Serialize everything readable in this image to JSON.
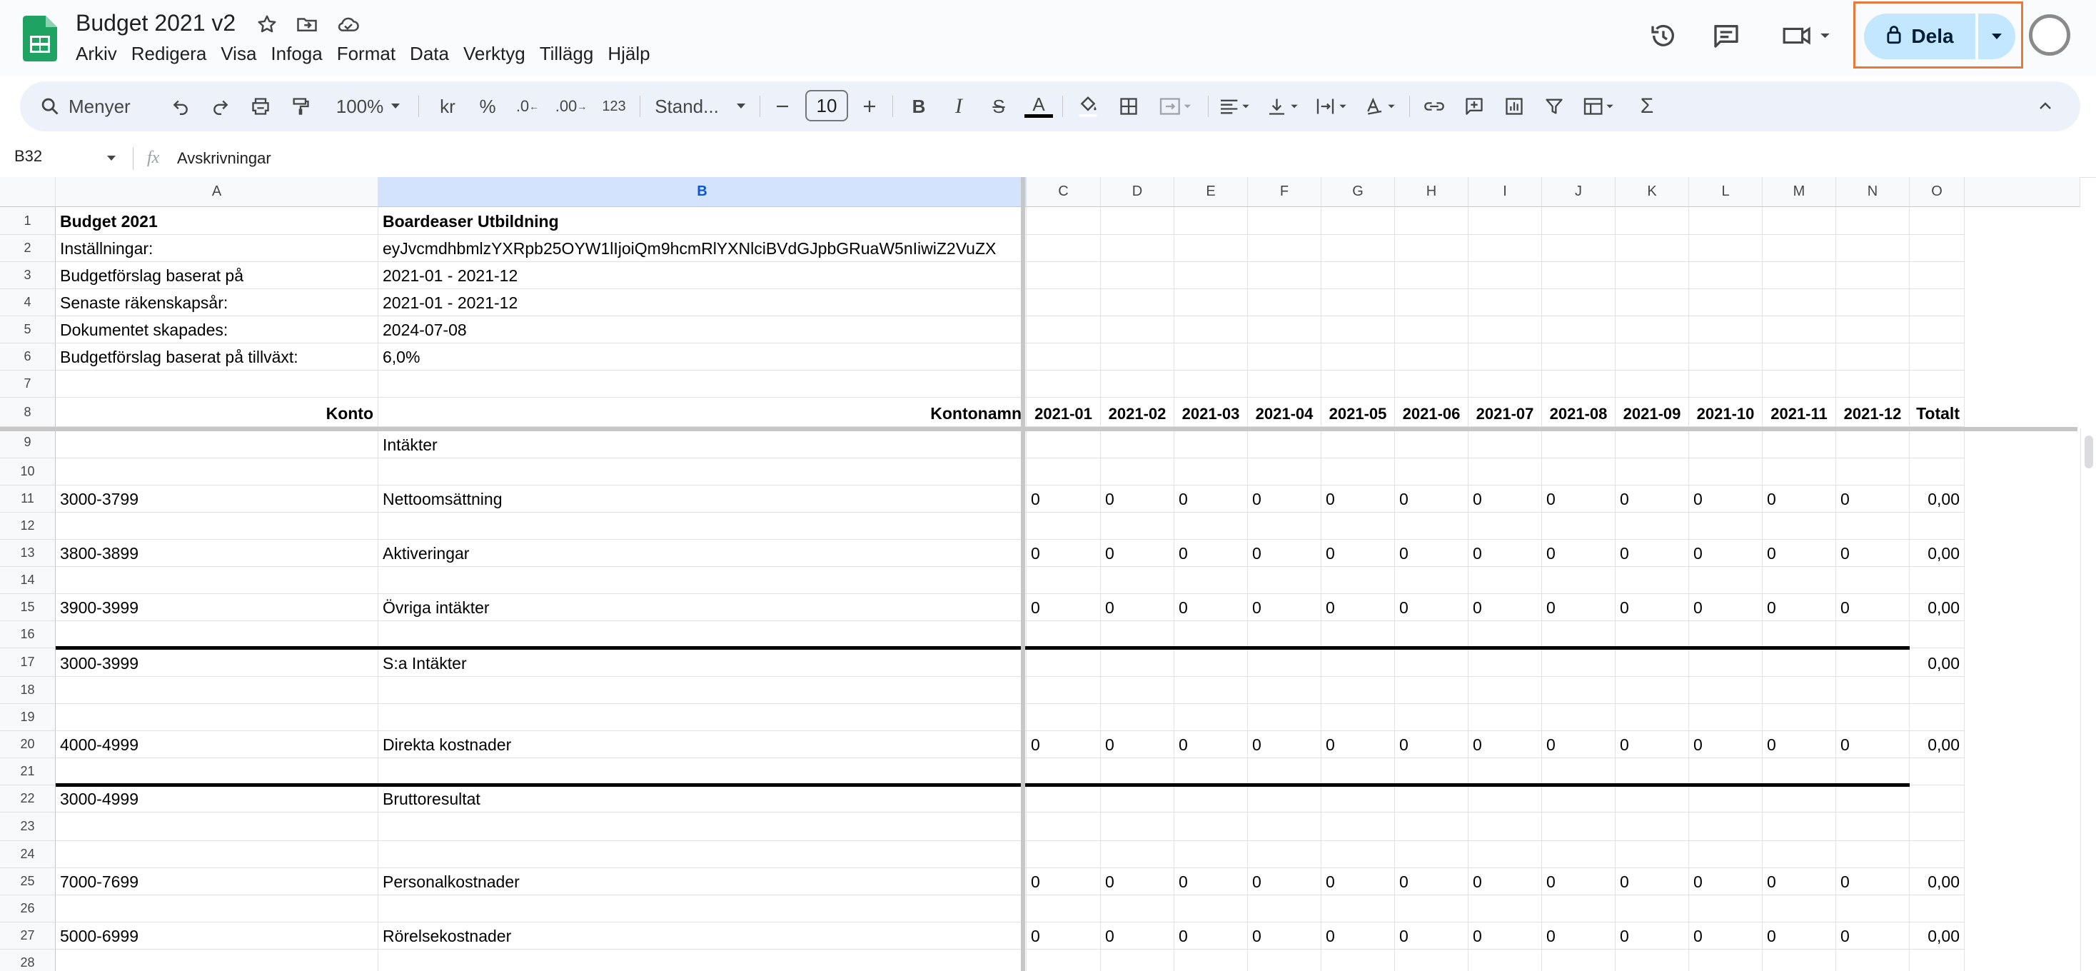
{
  "app": {
    "title": "Budget 2021 v2",
    "menu": [
      "Arkiv",
      "Redigera",
      "Visa",
      "Infoga",
      "Format",
      "Data",
      "Verktyg",
      "Tillägg",
      "Hjälp"
    ],
    "share_label": "Dela"
  },
  "toolbar": {
    "search_placeholder": "Menyer",
    "zoom": "100%",
    "currency": "kr",
    "percent": "%",
    "dec_decrease": ".0",
    "dec_increase": ".00",
    "number_format": "123",
    "font": "Stand...",
    "font_size": "10"
  },
  "formula_bar": {
    "cell_ref": "B32",
    "fx": "fx",
    "content": "Avskrivningar"
  },
  "columns": [
    "A",
    "B",
    "C",
    "D",
    "E",
    "F",
    "G",
    "H",
    "I",
    "J",
    "K",
    "L",
    "M",
    "N",
    "O"
  ],
  "selected_column": "B",
  "rows": [
    {
      "n": "1",
      "A": "Budget 2021",
      "B": "Boardeaser Utbildning",
      "bold": true
    },
    {
      "n": "2",
      "A": "Inställningar:",
      "B": "eyJvcmdhbmlzYXRpb25OYW1lIjoiQm9hcmRlYXNlciBVdGJpbGRuaW5nIiwiZ2VuZX"
    },
    {
      "n": "3",
      "A": "Budgetförslag baserat på",
      "B": "2021-01 - 2021-12"
    },
    {
      "n": "4",
      "A": "Senaste räkenskapsår:",
      "B": "2021-01 - 2021-12"
    },
    {
      "n": "5",
      "A": "Dokumentet skapades:",
      "B": "2024-07-08"
    },
    {
      "n": "6",
      "A": "Budgetförslag baserat på tillväxt:",
      "B": "6,0%"
    },
    {
      "n": "7"
    },
    {
      "n": "8",
      "A": "Konto",
      "B": "Kontonamn",
      "months": [
        "2021-01",
        "2021-02",
        "2021-03",
        "2021-04",
        "2021-05",
        "2021-06",
        "2021-07",
        "2021-08",
        "2021-09",
        "2021-10",
        "2021-11",
        "2021-12"
      ],
      "total": "Totalt",
      "header": true
    },
    {
      "n": "9",
      "B": "Intäkter"
    },
    {
      "n": "10"
    },
    {
      "n": "11",
      "A": "3000-3799",
      "B": "Nettoomsättning",
      "zeros": true,
      "total": "0,00"
    },
    {
      "n": "12"
    },
    {
      "n": "13",
      "A": "3800-3899",
      "B": "Aktiveringar",
      "zeros": true,
      "total": "0,00"
    },
    {
      "n": "14"
    },
    {
      "n": "15",
      "A": "3900-3999",
      "B": "Övriga intäkter",
      "zeros": true,
      "total": "0,00"
    },
    {
      "n": "16"
    },
    {
      "n": "17",
      "A": "3000-3999",
      "B": "S:a Intäkter",
      "total": "0,00",
      "thick_top": true
    },
    {
      "n": "18"
    },
    {
      "n": "19"
    },
    {
      "n": "20",
      "A": "4000-4999",
      "B": "Direkta kostnader",
      "zeros": true,
      "total": "0,00"
    },
    {
      "n": "21"
    },
    {
      "n": "22",
      "A": "3000-4999",
      "B": "Bruttoresultat",
      "thick_top": true
    },
    {
      "n": "23"
    },
    {
      "n": "24"
    },
    {
      "n": "25",
      "A": "7000-7699",
      "B": "Personalkostnader",
      "zeros": true,
      "total": "0,00"
    },
    {
      "n": "26"
    },
    {
      "n": "27",
      "A": "5000-6999",
      "B": "Rörelsekostnader",
      "zeros": true,
      "total": "0,00"
    },
    {
      "n": "28"
    }
  ],
  "zero_value": "0",
  "colors": {
    "share_bg": "#c2e7ff",
    "share_outline": "#e8793a",
    "selected_header": "#d3e3fd",
    "toolbar_bg": "#edf2fa",
    "sheets_green": "#1ea362"
  }
}
